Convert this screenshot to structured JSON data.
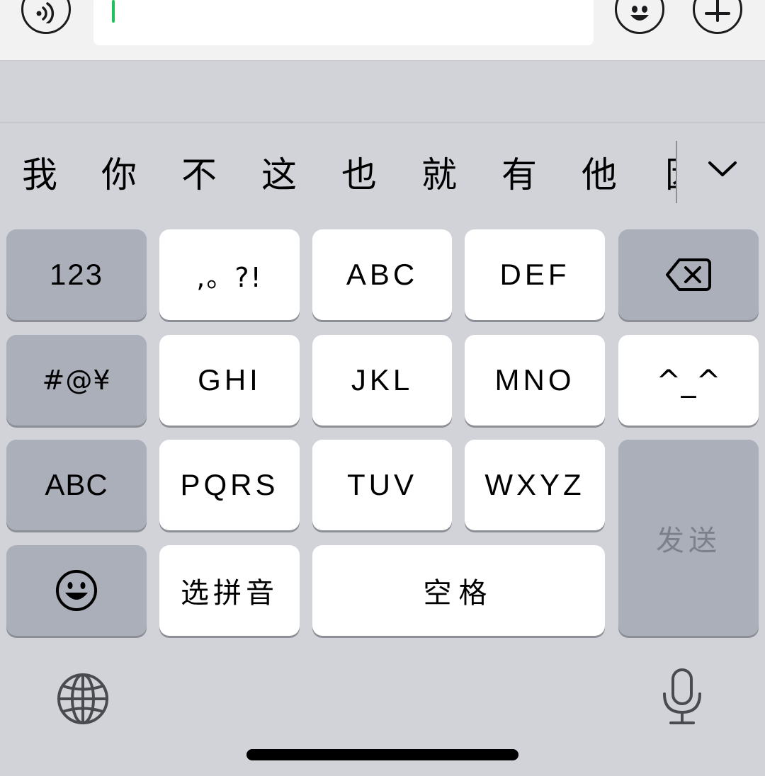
{
  "input_bar": {
    "voice_icon": "voice-wave-icon",
    "emoji_icon": "smiley-icon",
    "plus_icon": "plus-icon",
    "caret_color": "#1fc15a",
    "text": ""
  },
  "candidates": {
    "items": [
      "我",
      "你",
      "不",
      "这",
      "也",
      "就",
      "有",
      "他",
      "因"
    ],
    "expand_icon": "chevron-down-icon"
  },
  "keyboard": {
    "keys": {
      "num": "123",
      "punct": ",。?!",
      "abc_top": "ABC",
      "def": "DEF",
      "backspace_icon": "backspace-icon",
      "sym": "#@¥",
      "ghi": "GHI",
      "jkl": "JKL",
      "mno": "MNO",
      "kaomoji": "^_^",
      "abc_mode": "ABC",
      "pqrs": "PQRS",
      "tuv": "TUV",
      "wxyz": "WXYZ",
      "send": "发送",
      "emoji_icon": "smiley-icon",
      "pinyin": "选拼音",
      "space": "空格"
    },
    "globe_icon": "globe-icon",
    "mic_icon": "microphone-icon"
  },
  "colors": {
    "keyboard_bg": "#d1d3d9",
    "key_light": "#ffffff",
    "key_dark": "#abafba"
  }
}
